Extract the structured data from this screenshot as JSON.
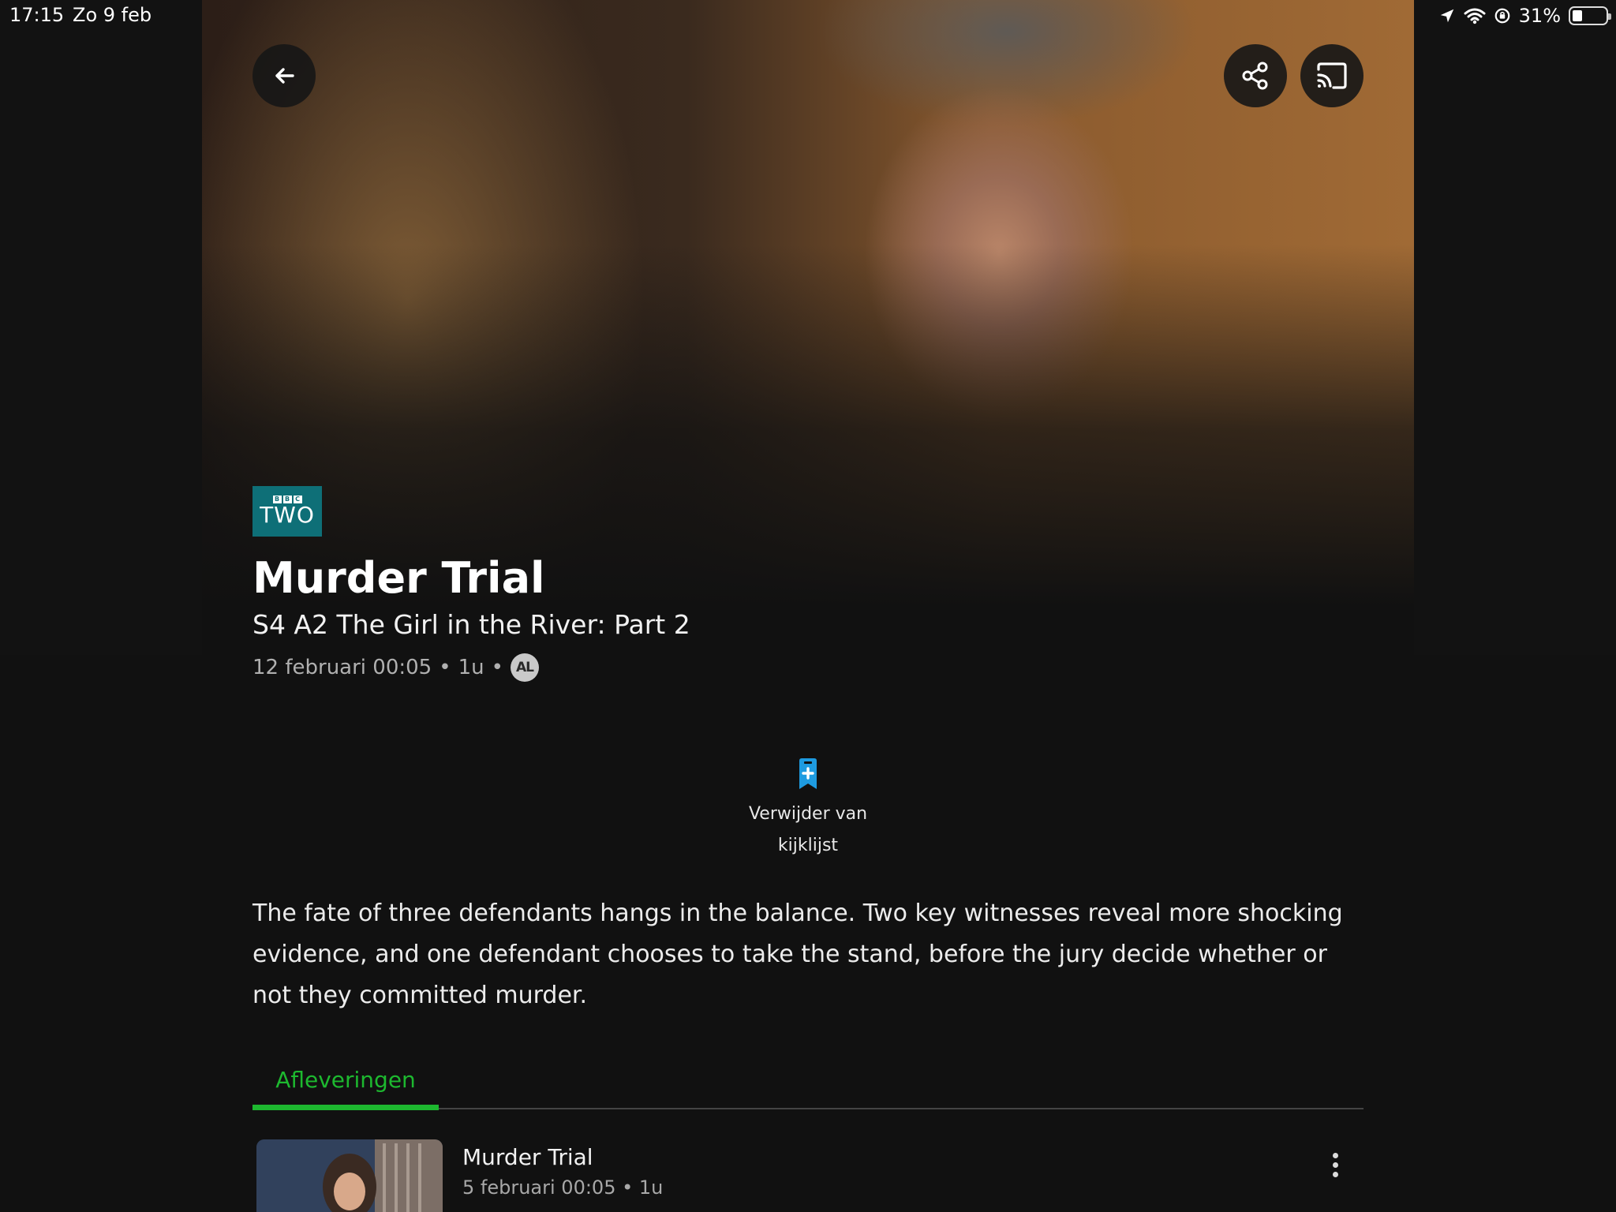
{
  "status_bar": {
    "time": "17:15",
    "date": "Zo 9 feb",
    "battery_percent": "31%",
    "battery_level": 0.31
  },
  "header": {
    "back_icon": "arrow-left-icon",
    "share_icon": "share-icon",
    "cast_icon": "cast-icon"
  },
  "program": {
    "channel_logo": {
      "top_text": "BBC",
      "bottom_text": "TWO"
    },
    "title": "Murder Trial",
    "episode_title": "S4 A2 The Girl in the River: Part 2",
    "air_info": "12 februari 00:05",
    "separator": "•",
    "duration": "1u",
    "rating": "AL"
  },
  "watchlist": {
    "icon": "bookmark-plus-icon",
    "label": "Verwijder van kijklijst"
  },
  "description": "The fate of three defendants hangs in the balance. Two key witnesses reveal more shocking evidence, and one defendant chooses to take the stand, before the jury decide whether or not they committed murder.",
  "tabs": [
    {
      "label": "Afleveringen",
      "active": true
    }
  ],
  "episodes": [
    {
      "title": "Murder Trial",
      "air_info": "5 februari 00:05",
      "separator": "•",
      "duration": "1u"
    }
  ],
  "colors": {
    "background": "#111111",
    "accent_green": "#1db82f",
    "watchlist_blue": "#1e9be0",
    "channel_teal": "#0e6f77"
  }
}
